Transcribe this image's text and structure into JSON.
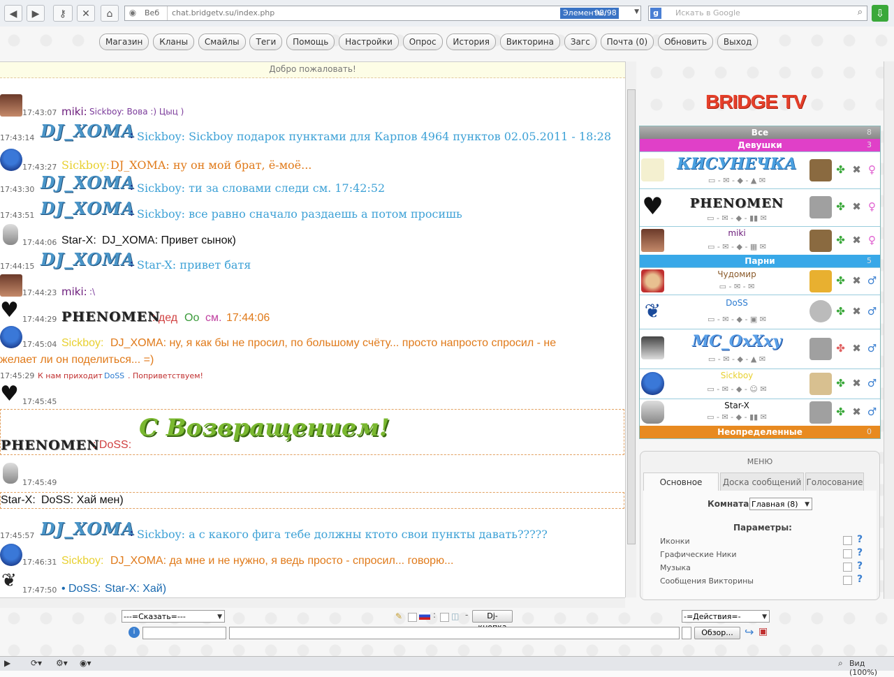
{
  "browser": {
    "site_label": "Веб",
    "url": "chat.bridgetv.su/index.php",
    "elements_label": "Элементы:",
    "elements_count": "98/98",
    "search_placeholder": "Искать в Google",
    "zoom_label": "Вид (100%)",
    "icons": [
      "back-icon",
      "forward-icon",
      "key-icon",
      "stop-icon",
      "home-icon",
      "globe-icon",
      "search-icon",
      "download-icon"
    ]
  },
  "nav": {
    "buttons": [
      "Магазин",
      "Кланы",
      "Смайлы",
      "Теги",
      "Помощь",
      "Настройки",
      "Опрос",
      "История",
      "Викторина",
      "Загс",
      "Почта (0)",
      "Обновить",
      "Выход"
    ]
  },
  "chat": {
    "welcome": "Добро пожаловать!",
    "messages": [
      {
        "time": "17:43:07",
        "nick": "miki:",
        "text": "Sickboy: Вова :) Цыц )"
      },
      {
        "time": "17:43:14",
        "nick": "DJ_XOMA",
        "text": "Sickboy: Sickboy подарок пунктами для Карпов 4964 пунктов 02.05.2011 - 18:28"
      },
      {
        "time": "17:43:27",
        "nick": "Sickboy:",
        "text": "DJ_XOMA: ну он мой брат, ё-моё..."
      },
      {
        "time": "17:43:30",
        "nick": "DJ_XOMA",
        "text": "Sickboy: ти за словами следи см. 17:42:52"
      },
      {
        "time": "17:43:51",
        "nick": "DJ_XOMA",
        "text": "Sickboy: все равно сначало раздаешь а потом просишь"
      },
      {
        "time": "17:44:06",
        "nick": "Star-X:",
        "text": "DJ_XOMA: Привет сынок)"
      },
      {
        "time": "17:44:15",
        "nick": "DJ_XOMA",
        "text": "Star-X: привет батя"
      },
      {
        "time": "17:44:23",
        "nick": "miki:",
        "text": ":\\"
      },
      {
        "time": "17:44:29",
        "nick": "PHENOMEN",
        "text_parts": [
          ": дед ",
          "Оо ",
          "см. ",
          "17:44:06"
        ]
      },
      {
        "time": "17:45:04",
        "nick": "Sickboy:",
        "text": "DJ_XOMA: ну, я как бы не просил, по большому счёту... просто напросто спросил - не",
        "text2": "желает ли он поделиться... =)"
      },
      {
        "time": "17:45:29",
        "system_prefix": "К нам приходит ",
        "system_nick": "DoSS",
        "system_suffix": ". Поприветствуем!"
      },
      {
        "time": "17:45:45",
        "nick": "PHENOMEN",
        "target": ": DoSS:",
        "banner": "С Возвращением!"
      },
      {
        "time": "17:45:49",
        "nick": "Star-X:",
        "text": "DoSS: Хай мен)"
      },
      {
        "time": "17:45:57",
        "nick": "DJ_XOMA",
        "text": "Sickboy: а с какого фига тебе должны ктото свои пункты давать?????"
      },
      {
        "time": "17:46:31",
        "nick": "Sickboy:",
        "text": "DJ_XOMA: да мне и не нужно, я ведь просто - спросил... говорю..."
      },
      {
        "time": "17:47:50",
        "nick": "• DoSS:",
        "text": "Star-X: Хай)"
      }
    ]
  },
  "userlist": {
    "logo": "BRIDGE TV",
    "groups": [
      {
        "label": "Все",
        "count": "8"
      },
      {
        "label": "Девушки",
        "count": "3"
      },
      {
        "label": "Парни",
        "count": "5"
      },
      {
        "label": "Неопределенные",
        "count": "0"
      }
    ],
    "girls": [
      "КИСУНЕЧКА",
      "PHENOMEN",
      "miki"
    ],
    "boys": [
      "Чудомир",
      "DoSS",
      "MC_OxXxy",
      "Sickboy",
      "Star-X"
    ]
  },
  "menu": {
    "title": "МЕНЮ",
    "tabs": [
      "Основное",
      "Доска сообщений",
      "Голосование"
    ],
    "room_label": "Комната:",
    "room_value": "Главная (8)",
    "params_title": "Параметры:",
    "params": [
      "Иконки",
      "Графические Ники",
      "Музыка",
      "Сообщения Викторины"
    ],
    "help_glyph": "?"
  },
  "input": {
    "say_select": "---=Сказать=---",
    "dj_button": "Dj-кнопка",
    "actions_select": "-=Действия=-",
    "browse_button": "Обзор..."
  }
}
